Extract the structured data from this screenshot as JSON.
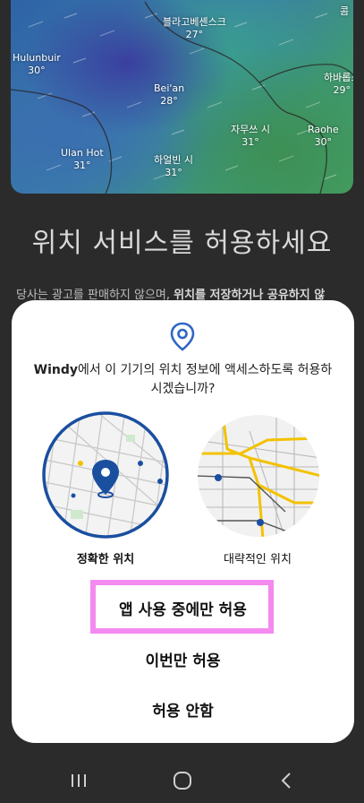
{
  "map": {
    "cities": [
      {
        "name": "블라고베셴스크",
        "temp": "27°"
      },
      {
        "name": "Hulunbuir",
        "temp": "30°"
      },
      {
        "name": "Bei'an",
        "temp": "28°"
      },
      {
        "name": "하바롭스",
        "temp": "29°"
      },
      {
        "name": "자무쓰 시",
        "temp": "31°"
      },
      {
        "name": "Raohe",
        "temp": "30°"
      },
      {
        "name": "Ulan Hot",
        "temp": "31°"
      },
      {
        "name": "하얼빈 시",
        "temp": "31°"
      },
      {
        "name": "콤",
        "temp": ""
      }
    ]
  },
  "background": {
    "title": "위치 서비스를 허용하세요",
    "subtitle_plain": "당사는 광고를 판매하지 않으며, ",
    "subtitle_bold": "위치를 저장하거나 공유하지 않"
  },
  "dialog": {
    "app_name": "Windy",
    "question_rest": "에서 이 기기의 위치 정보에 액세스하도록 허용하시겠습니까?",
    "precise_label": "정확한 위치",
    "approx_label": "대략적인 위치",
    "buttons": {
      "while_using": "앱 사용 중에만 허용",
      "only_this_time": "이번만 허용",
      "deny": "허용 안함"
    }
  },
  "colors": {
    "accent_blue": "#1a4fa0",
    "highlight": "#f48af0",
    "road_yellow": "#f2c200"
  }
}
